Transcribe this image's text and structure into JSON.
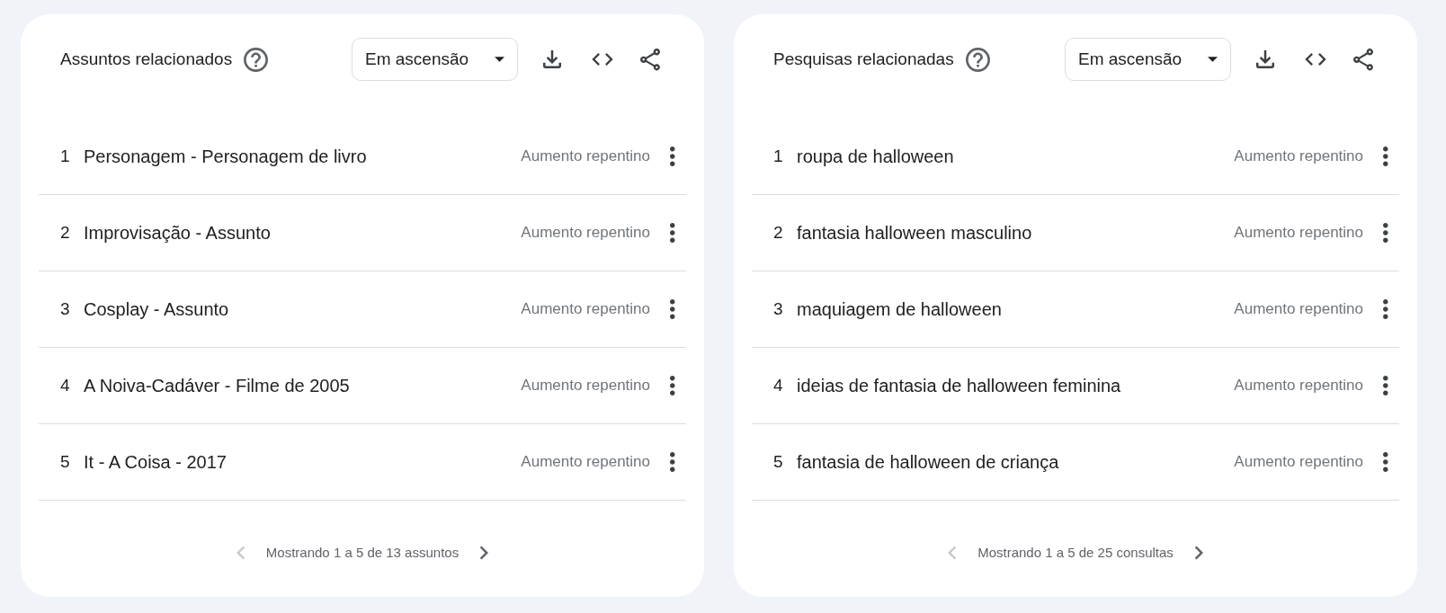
{
  "panels": [
    {
      "title": "Assuntos relacionados",
      "filter": {
        "value": "Em ascensão"
      },
      "rows": [
        {
          "rank": "1",
          "label": "Personagem - Personagem de livro",
          "value": "Aumento repentino"
        },
        {
          "rank": "2",
          "label": "Improvisação - Assunto",
          "value": "Aumento repentino"
        },
        {
          "rank": "3",
          "label": "Cosplay - Assunto",
          "value": "Aumento repentino"
        },
        {
          "rank": "4",
          "label": "A Noiva-Cadáver - Filme de 2005",
          "value": "Aumento repentino"
        },
        {
          "rank": "5",
          "label": "It - A Coisa - 2017",
          "value": "Aumento repentino"
        }
      ],
      "pagination": {
        "previous": {
          "disabled": true
        },
        "text": "Mostrando 1 a 5 de 13 assuntos",
        "next": {
          "disabled": false
        }
      }
    },
    {
      "title": "Pesquisas relacionadas",
      "filter": {
        "value": "Em ascensão"
      },
      "rows": [
        {
          "rank": "1",
          "label": "roupa de halloween",
          "value": "Aumento repentino"
        },
        {
          "rank": "2",
          "label": "fantasia halloween masculino",
          "value": "Aumento repentino"
        },
        {
          "rank": "3",
          "label": "maquiagem de halloween",
          "value": "Aumento repentino"
        },
        {
          "rank": "4",
          "label": "ideias de fantasia de halloween feminina",
          "value": "Aumento repentino"
        },
        {
          "rank": "5",
          "label": "fantasia de halloween de criança",
          "value": "Aumento repentino"
        }
      ],
      "pagination": {
        "previous": {
          "disabled": true
        },
        "text": "Mostrando 1 a 5 de 25 consultas",
        "next": {
          "disabled": false
        }
      }
    }
  ]
}
